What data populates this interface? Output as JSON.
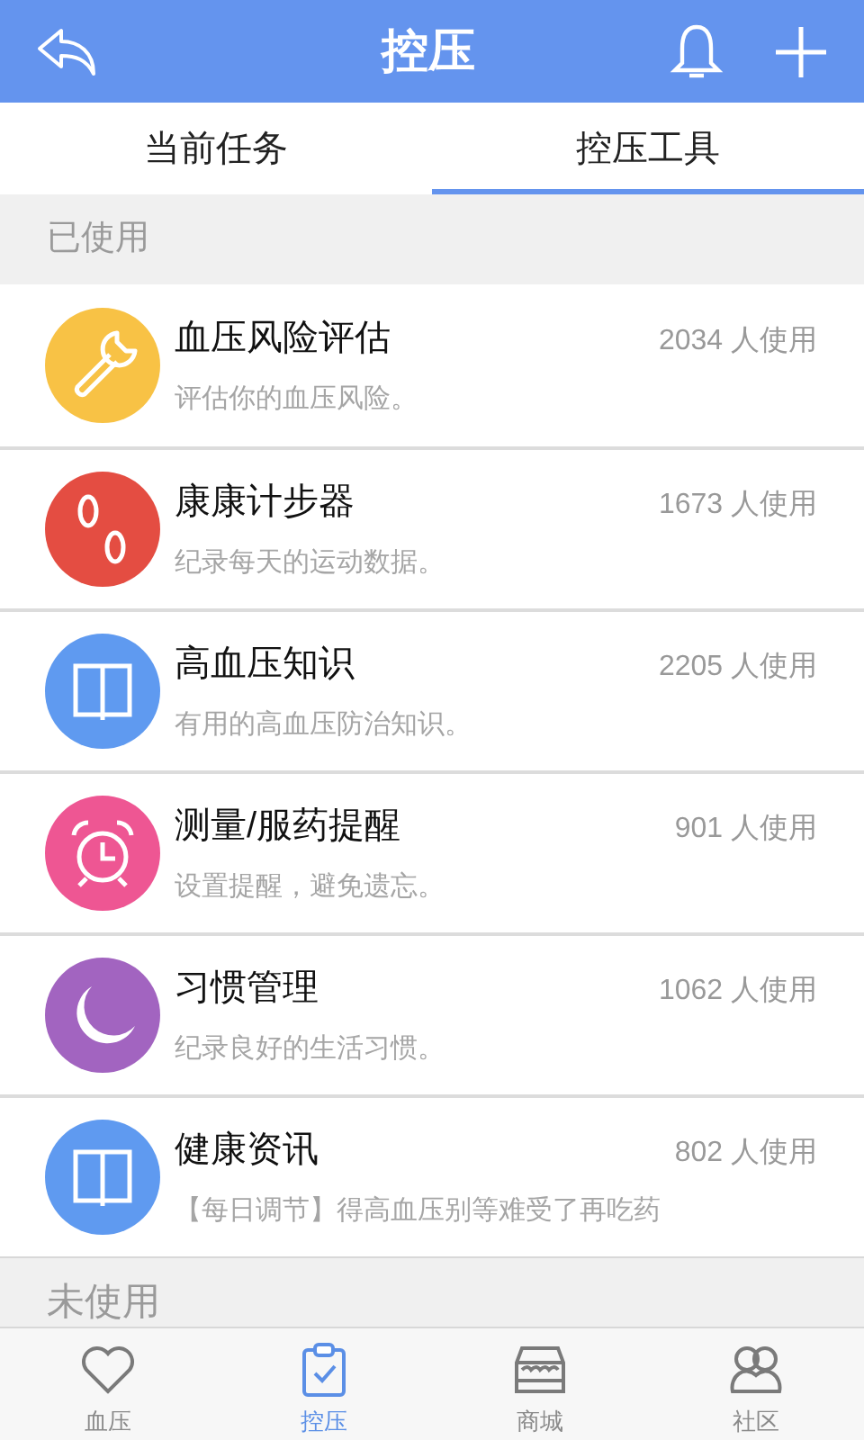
{
  "header": {
    "title": "控压"
  },
  "tabs": [
    {
      "label": "当前任务",
      "selected": false
    },
    {
      "label": "控压工具",
      "selected": true
    }
  ],
  "sections": [
    {
      "title": "已使用",
      "items": [
        {
          "kind": "wrench",
          "color": "#f8c245",
          "name": "血压风险评估",
          "count": "2034 人使用",
          "description": "评估你的血压风险。"
        },
        {
          "kind": "feet",
          "color": "#e44d42",
          "name": "康康计步器",
          "count": "1673 人使用",
          "description": "纪录每天的运动数据。"
        },
        {
          "kind": "book",
          "color": "#5f9af0",
          "name": "高血压知识",
          "count": "2205 人使用",
          "description": "有用的高血压防治知识。"
        },
        {
          "kind": "alarm",
          "color": "#ee5693",
          "name": "测量/服药提醒",
          "count": "901 人使用",
          "description": "设置提醒，避免遗忘。"
        },
        {
          "kind": "moon",
          "color": "#a264c0",
          "name": "习惯管理",
          "count": "1062 人使用",
          "description": "纪录良好的生活习惯。"
        },
        {
          "kind": "book",
          "color": "#5f9af0",
          "name": "健康资讯",
          "count": "802 人使用",
          "description": "【每日调节】得高血压别等难受了再吃药"
        }
      ]
    },
    {
      "title": "未使用"
    }
  ],
  "bottom_nav": [
    {
      "kind": "heart",
      "label": "血压",
      "selected": false
    },
    {
      "kind": "clipboard",
      "label": "控压",
      "selected": true
    },
    {
      "kind": "store",
      "label": "商城",
      "selected": false
    },
    {
      "kind": "people",
      "label": "社区",
      "selected": false
    }
  ]
}
